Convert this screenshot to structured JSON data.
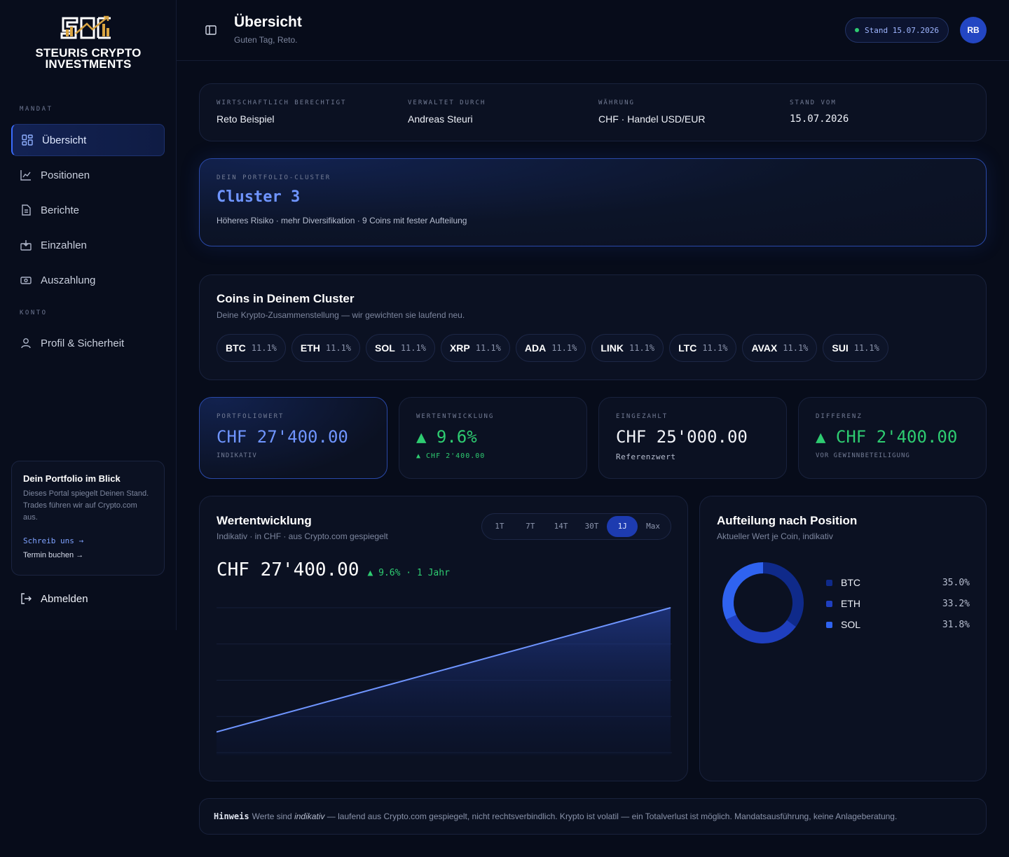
{
  "brand": {
    "line1": "STEURIS CRYPTO",
    "line2": "INVESTMENTS"
  },
  "sidebar": {
    "section_mandat": "MANDAT",
    "section_konto": "KONTO",
    "items": [
      {
        "label": "Übersicht",
        "icon": "grid-icon"
      },
      {
        "label": "Positionen",
        "icon": "line-chart-icon"
      },
      {
        "label": "Berichte",
        "icon": "document-icon"
      },
      {
        "label": "Einzahlen",
        "icon": "deposit-icon"
      },
      {
        "label": "Auszahlung",
        "icon": "cash-icon"
      },
      {
        "label": "Profil & Sicherheit",
        "icon": "user-icon"
      }
    ],
    "promo": {
      "title": "Dein Portfolio im Blick",
      "text": "Dieses Portal spiegelt Deinen Stand. Trades führen wir auf Crypto.com aus.",
      "link_write": "Schreib uns →",
      "link_book": "Termin buchen →"
    },
    "logout": "Abmelden"
  },
  "header": {
    "title": "Übersicht",
    "subtitle": "Guten Tag, Reto.",
    "stand": "Stand 15.07.2026",
    "avatar": "RB"
  },
  "info": [
    {
      "label": "WIRTSCHAFTLICH BERECHTIGT",
      "value": "Reto Beispiel"
    },
    {
      "label": "VERWALTET DURCH",
      "value": "Andreas Steuri"
    },
    {
      "label": "WÄHRUNG",
      "value": "CHF · Handel USD/EUR"
    },
    {
      "label": "STAND VOM",
      "value": "15.07.2026"
    }
  ],
  "cluster": {
    "label": "DEIN PORTFOLIO-CLUSTER",
    "name": "Cluster 3",
    "desc": "Höheres Risiko · mehr Diversifikation · 9 Coins mit fester Aufteilung"
  },
  "coins": {
    "title": "Coins in Deinem Cluster",
    "subtitle": "Deine Krypto-Zusammenstellung — wir gewichten sie laufend neu.",
    "list": [
      {
        "sym": "BTC",
        "pct": "11.1%"
      },
      {
        "sym": "ETH",
        "pct": "11.1%"
      },
      {
        "sym": "SOL",
        "pct": "11.1%"
      },
      {
        "sym": "XRP",
        "pct": "11.1%"
      },
      {
        "sym": "ADA",
        "pct": "11.1%"
      },
      {
        "sym": "LINK",
        "pct": "11.1%"
      },
      {
        "sym": "LTC",
        "pct": "11.1%"
      },
      {
        "sym": "AVAX",
        "pct": "11.1%"
      },
      {
        "sym": "SUI",
        "pct": "11.1%"
      }
    ]
  },
  "kpis": [
    {
      "label": "PORTFOLIOWERT",
      "value": "CHF 27'400.00",
      "sub": "INDIKATIV"
    },
    {
      "label": "WERTENTWICKLUNG",
      "value": "▲ 9.6%",
      "sub": "▲ CHF 2'400.00"
    },
    {
      "label": "EINGEZAHLT",
      "value": "CHF 25'000.00",
      "sub": "Referenzwert"
    },
    {
      "label": "DIFFERENZ",
      "value": "▲ CHF 2'400.00",
      "sub": "VOR GEWINNBETEILIGUNG"
    }
  ],
  "performance": {
    "title": "Wertentwicklung",
    "subtitle": "Indikativ · in CHF · aus Crypto.com gespiegelt",
    "ranges": [
      "1T",
      "7T",
      "14T",
      "30T",
      "1J",
      "Max"
    ],
    "active_range": "1J",
    "value": "CHF 27'400.00",
    "change": "▲ 9.6% · 1 Jahr"
  },
  "allocation": {
    "title": "Aufteilung nach Position",
    "subtitle": "Aktueller Wert je Coin, indikativ"
  },
  "colors": {
    "accent": "#3b6cff",
    "positive": "#2ecc71",
    "btc": "#0f2a8a",
    "eth": "#1f3fbf",
    "sol": "#2f63f0"
  },
  "chart_data": [
    {
      "type": "area",
      "x": [
        "start",
        "end"
      ],
      "series": [
        {
          "values": [
            25000,
            27400
          ]
        }
      ],
      "ylim": [
        24600,
        27400
      ],
      "grid": true
    },
    {
      "type": "pie",
      "categories": [
        "BTC",
        "ETH",
        "SOL"
      ],
      "values": [
        35.0,
        33.2,
        31.8
      ],
      "labels": [
        "35.0%",
        "33.2%",
        "31.8%"
      ]
    }
  ],
  "hinweis": {
    "bold": "Hinweis",
    "pre": "Werte sind",
    "italic": "indikativ",
    "post": "— laufend aus Crypto.com gespiegelt, nicht rechtsverbindlich. Krypto ist volatil — ein Totalverlust ist möglich. Mandatsausführung, keine Anlageberatung."
  }
}
